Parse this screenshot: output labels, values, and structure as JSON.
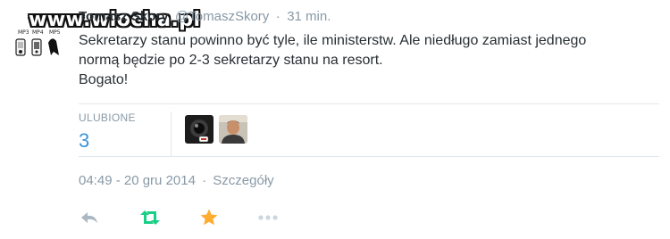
{
  "watermark": {
    "text": "www.wiocha.pl",
    "captions": [
      "MP3",
      "MP4",
      "MP5"
    ]
  },
  "tweet": {
    "display_name": "Tomasz Skory",
    "screen_name": "@TomaszSkory",
    "separator": "·",
    "time_ago": "31 min.",
    "text_lines": [
      "Sekretarzy stanu powinno być tyle, ile ministerstw. Ale niedługo zamiast jednego",
      "normą będzie po 2-3 sekretarzy stanu na resort.",
      "Bogato!"
    ]
  },
  "stats": {
    "likes_label": "ULUBIONE",
    "likes_count": "3"
  },
  "meta": {
    "datetime": "04:49 - 20 gru 2014",
    "separator": "·",
    "details_link": "Szczegóły"
  },
  "actions": {
    "reply_icon": "reply-icon",
    "retweet_icon": "retweet-icon",
    "favorite_icon": "star-icon",
    "more_icon": "more-icon"
  },
  "colors": {
    "link": "#3b94d9",
    "muted": "#8899a6",
    "retweet": "#19cf86",
    "favorite": "#ffac33",
    "text": "#292f33"
  }
}
